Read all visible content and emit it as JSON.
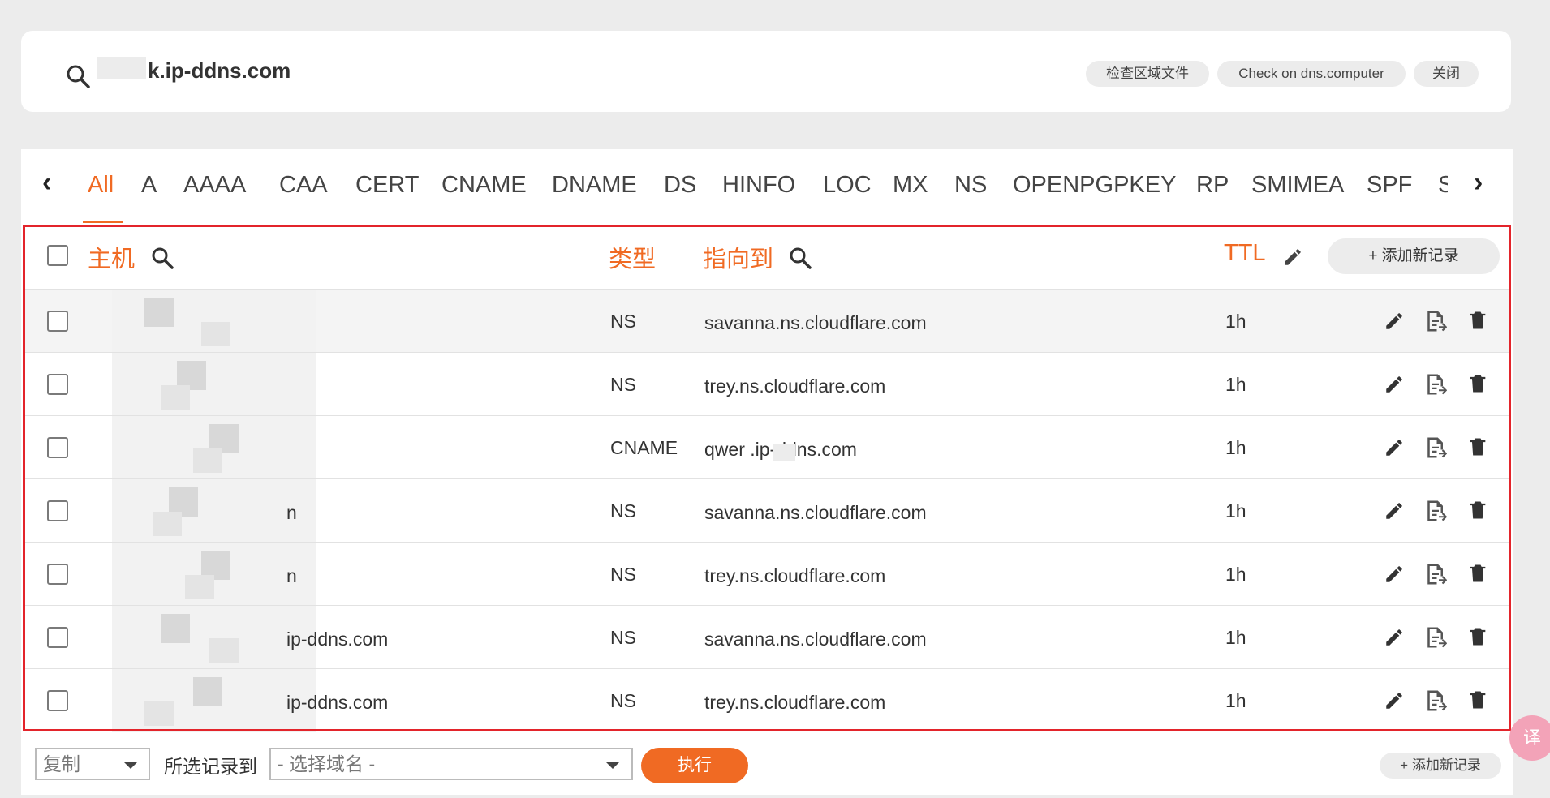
{
  "top": {
    "domain": "k.ip-ddns.com",
    "buttons": [
      "检查区域文件",
      "Check on dns.computer",
      "关闭"
    ]
  },
  "tabs": {
    "items": [
      "All",
      "A",
      "AAAA",
      "CAA",
      "CERT",
      "CNAME",
      "DNAME",
      "DS",
      "HINFO",
      "LOC",
      "MX",
      "NS",
      "OPENPGPKEY",
      "RP",
      "SMIMEA",
      "SPF",
      "S"
    ],
    "active": "All"
  },
  "table": {
    "headers": {
      "host": "主机",
      "type": "类型",
      "target": "指向到",
      "ttl": "TTL"
    },
    "add_label": "+ 添加新记录",
    "rows": [
      {
        "host": "",
        "type": "NS",
        "target": "savanna.ns.cloudflare.com",
        "ttl": "1h"
      },
      {
        "host": "",
        "type": "NS",
        "target": "trey.ns.cloudflare.com",
        "ttl": "1h"
      },
      {
        "host": "",
        "type": "CNAME",
        "target": "qwer       .ip-ddns.com",
        "ttl": "1h"
      },
      {
        "host": "n",
        "type": "NS",
        "target": "savanna.ns.cloudflare.com",
        "ttl": "1h"
      },
      {
        "host": "n",
        "type": "NS",
        "target": "trey.ns.cloudflare.com",
        "ttl": "1h"
      },
      {
        "host": "ip-ddns.com",
        "type": "NS",
        "target": "savanna.ns.cloudflare.com",
        "ttl": "1h"
      },
      {
        "host": "ip-ddns.com",
        "type": "NS",
        "target": "trey.ns.cloudflare.com",
        "ttl": "1h"
      }
    ]
  },
  "bottom": {
    "copy_select": "复制",
    "label": "所选记录到",
    "domain_select": "- 选择域名 -",
    "execute": "执行",
    "add_label": "+ 添加新记录"
  },
  "translate_icon": "译"
}
